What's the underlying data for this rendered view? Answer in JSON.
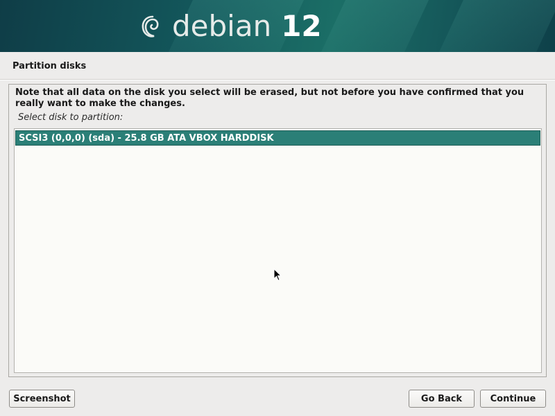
{
  "banner": {
    "brand_name": "debian",
    "brand_version": "12",
    "logo_icon": "debian-swirl-icon"
  },
  "page": {
    "title": "Partition disks"
  },
  "main": {
    "note": "Note that all data on the disk you select will be erased, but not before you have confirmed that you really want to make the changes.",
    "prompt": "Select disk to partition:",
    "disks": [
      {
        "label": "SCSI3 (0,0,0) (sda) - 25.8 GB ATA VBOX HARDDISK",
        "selected": true
      }
    ]
  },
  "buttons": {
    "screenshot": "Screenshot",
    "go_back": "Go Back",
    "continue": "Continue"
  },
  "colors": {
    "banner": "#13575b",
    "selection": "#2b7f77",
    "background": "#edeceb"
  }
}
